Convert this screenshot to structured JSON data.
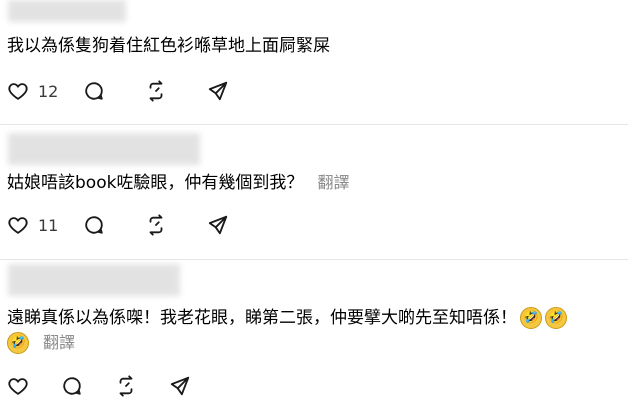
{
  "posts": [
    {
      "text": "我以為係隻狗着住紅色衫喺草地上面屙緊屎",
      "like_count": "12",
      "translate": ""
    },
    {
      "text": "姑娘唔該book咗驗眼，仲有幾個到我？",
      "like_count": "11",
      "translate": "翻譯"
    },
    {
      "text": "遠睇真係以為係㗎！我老花眼，睇第二張，仲要擘大啲先至知唔係！",
      "like_count": "",
      "translate": "翻譯",
      "emoji": "🤣"
    }
  ],
  "icons": {
    "like": "heart-icon",
    "reply": "comment-icon",
    "repost": "repost-icon",
    "share": "send-icon"
  }
}
